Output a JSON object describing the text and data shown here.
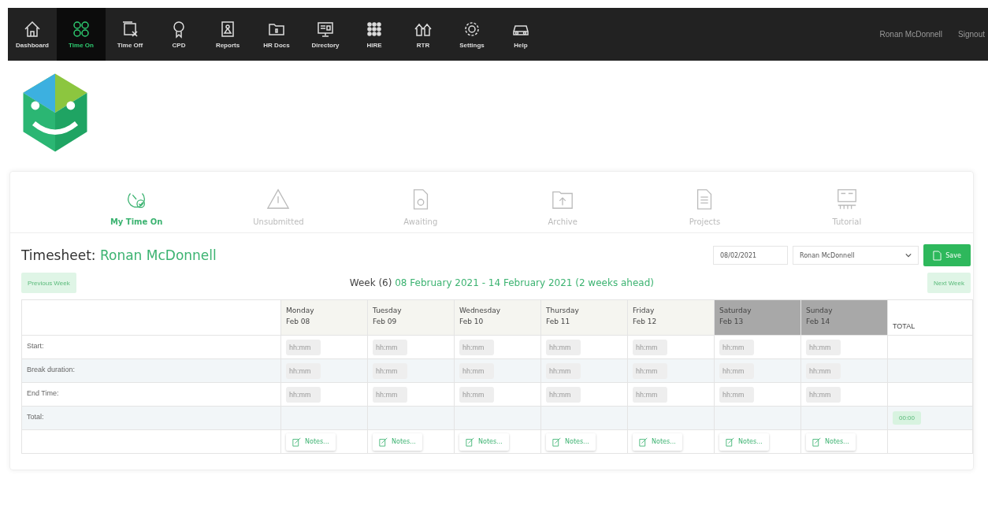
{
  "nav": [
    {
      "label": "Dashboard",
      "selected": false
    },
    {
      "label": "Time On",
      "selected": true
    },
    {
      "label": "Time Off",
      "selected": false
    },
    {
      "label": "CPD",
      "selected": false
    },
    {
      "label": "Reports",
      "selected": false
    },
    {
      "label": "HR Docs",
      "selected": false
    },
    {
      "label": "Directory",
      "selected": false
    },
    {
      "label": "HIRE",
      "selected": false
    },
    {
      "label": "RTR",
      "selected": false
    },
    {
      "label": "Settings",
      "selected": false
    },
    {
      "label": "Help",
      "selected": false
    }
  ],
  "user": "Ronan McDonnell",
  "signout": "Signout",
  "tabs": [
    {
      "label": "My Time On",
      "selected": true
    },
    {
      "label": "Unsubmitted",
      "selected": false
    },
    {
      "label": "Awaiting",
      "selected": false
    },
    {
      "label": "Archive",
      "selected": false
    },
    {
      "label": "Projects",
      "selected": false
    },
    {
      "label": "Tutorial",
      "selected": false
    }
  ],
  "timesheet": {
    "title": "Timesheet:",
    "name": "Ronan McDonnell",
    "date": "08/02/2021",
    "employee": "Ronan McDonnell",
    "save": "Save",
    "previous": "Previous Week",
    "next": "Next Week",
    "week_label": "Week (6)",
    "week_range": "08 February 2021 - 14 February 2021 (2 weeks ahead)"
  },
  "days": [
    {
      "day": "Monday",
      "date": "Feb 08",
      "weekend": false,
      "notes": "Notes..."
    },
    {
      "day": "Tuesday",
      "date": "Feb 09",
      "weekend": false,
      "notes": "Notes..."
    },
    {
      "day": "Wednesday",
      "date": "Feb 10",
      "weekend": false,
      "notes": "Notes..."
    },
    {
      "day": "Thursday",
      "date": "Feb 11",
      "weekend": false,
      "notes": "Notes..."
    },
    {
      "day": "Friday",
      "date": "Feb 12",
      "weekend": false,
      "notes": "Notes..."
    },
    {
      "day": "Saturday",
      "date": "Feb 13",
      "weekend": true,
      "notes": "Notes..."
    },
    {
      "day": "Sunday",
      "date": "Feb 14",
      "weekend": true,
      "notes": "Notes..."
    }
  ],
  "total_header": "TOTAL",
  "rows": [
    {
      "label": "Start:",
      "placeholders": [
        "hh:mm",
        "hh:mm",
        "hh:mm",
        "hh:mm",
        "hh:mm",
        "hh:mm",
        "hh:mm"
      ]
    },
    {
      "label": "Break duration:",
      "placeholders": [
        "hh:mm",
        "hh:mm",
        "hh:mm",
        "hh:mm",
        "hh:mm",
        "hh:mm",
        "hh:mm"
      ]
    },
    {
      "label": "End Time:",
      "placeholders": [
        "hh:mm",
        "hh:mm",
        "hh:mm",
        "hh:mm",
        "hh:mm",
        "hh:mm",
        "hh:mm"
      ]
    }
  ],
  "total_row": {
    "label": "Total:",
    "value": "00:00"
  }
}
